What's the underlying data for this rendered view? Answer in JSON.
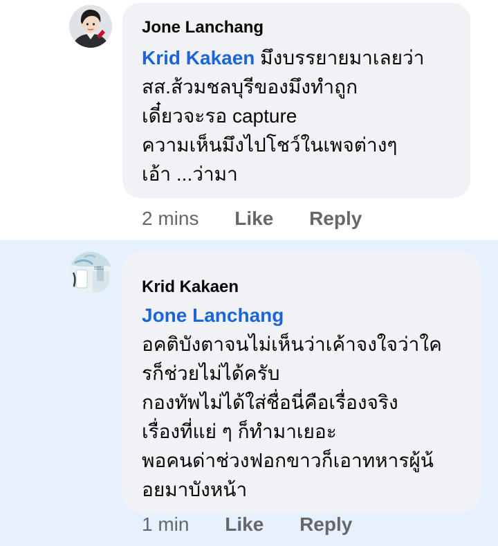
{
  "colors": {
    "mention": "#1b65d6",
    "bubble": "#f0f2f5",
    "highlight_row": "#e7f0fd",
    "meta_text": "#65676b"
  },
  "comments": [
    {
      "author": "Jone Lanchang",
      "mention": "Krid Kakaen",
      "first_line_rest": " มึงบรรยายมาเลยว่า",
      "lines": [
        "สส.ส้วมชลบุรีของมึงทำถูก",
        "เดี๋ยวจะรอ capture",
        "ความเห็นมึงไปโชว์ในเพจต่างๆ",
        "เอ้า ...ว่ามา"
      ],
      "time": "2 mins",
      "like_label": "Like",
      "reply_label": "Reply",
      "avatar_icon": "cartoon-face-avatar"
    },
    {
      "author": "Krid Kakaen",
      "mention": "Jone Lanchang",
      "lines": [
        "อคติบังตาจนไม่เห็นว่าเค้าจงใจว่าใค",
        "รก็ช่วยไม่ได้ครับ",
        "กองทัพไม่ได้ใส่ชื่อนี่คือเรื่องจริง",
        "เรื่องที่แย่ ๆ ก็ทำมาเยอะ",
        "พอคนด่าช่วงฟอกขาวก็เอาทหารผู้น้",
        "อยมาบังหน้า"
      ],
      "time": "1 min",
      "like_label": "Like",
      "reply_label": "Reply",
      "avatar_icon": "photo-avatar"
    }
  ]
}
